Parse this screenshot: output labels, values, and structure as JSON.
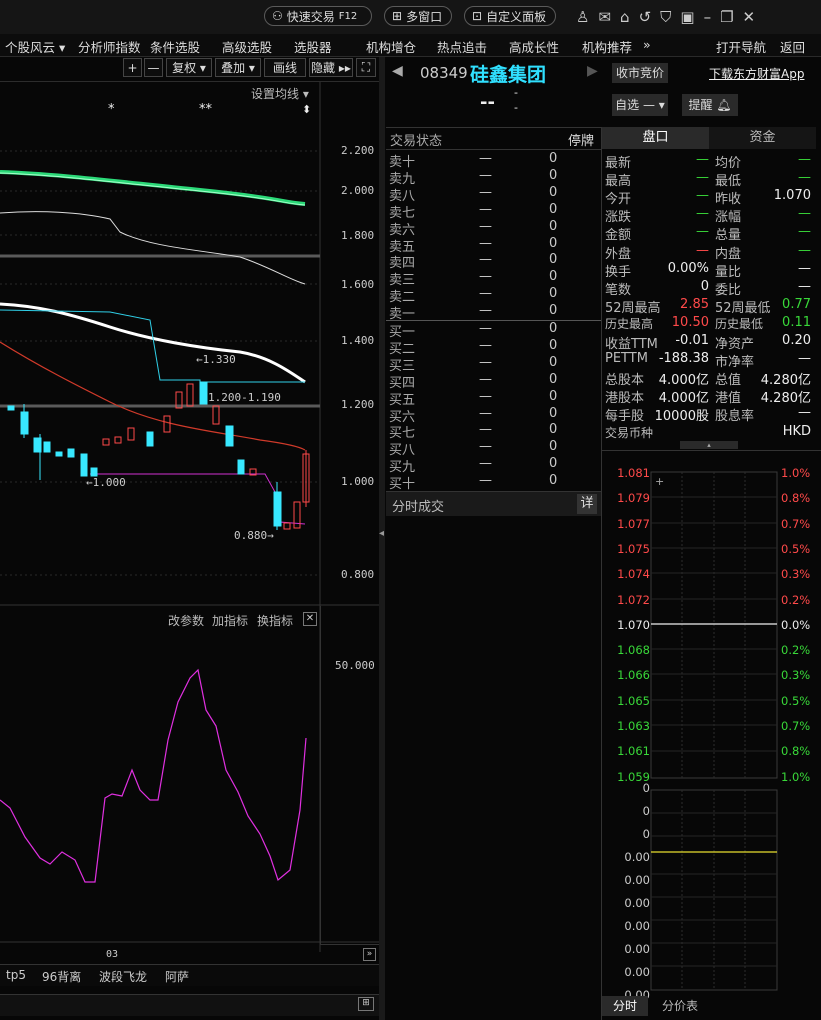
{
  "topbar": {
    "quick_trade": "快速交易",
    "quick_trade_key": "F12",
    "multi_window": "多窗口",
    "custom_panel": "自定义面板"
  },
  "menu": {
    "items": [
      "个股风云",
      "分析师指数",
      "条件选股",
      "高级选股",
      "选股器",
      "机构增仓",
      "热点追击",
      "高成长性",
      "机构推荐"
    ],
    "more": "»",
    "right": [
      "打开导航",
      "返回"
    ]
  },
  "chart_toolbar": {
    "plus": "+",
    "minus": "—",
    "restore": "复权",
    "overlay": "叠加",
    "draw": "画线",
    "hide": "隐藏"
  },
  "ma_setting": "设置均线",
  "stars": [
    "*",
    "**"
  ],
  "price_axis": [
    "2.200",
    "2.000",
    "1.800",
    "1.600",
    "1.400",
    "1.200",
    "1.000",
    "0.800"
  ],
  "annotations": {
    "high": "1.330",
    "gap": "1.200-1.190",
    "low1": "1.000",
    "low2": "0.880"
  },
  "indicator": {
    "params": "改参数",
    "add": "加指标",
    "switch": "换指标",
    "axis": "50.000",
    "xtick": "03"
  },
  "bottom_tabs": [
    "tp5",
    "96背离",
    "波段飞龙",
    "阿萨"
  ],
  "stock": {
    "code": "08349",
    "name": "硅鑫集团",
    "price": "--",
    "change1": "-",
    "change2": "-",
    "btn_market": "收市竞价",
    "download": "下载东方财富App",
    "watch": "自选",
    "remind": "提醒"
  },
  "orderbook": {
    "status_label": "交易状态",
    "status": "停牌",
    "sell": [
      "卖十",
      "卖九",
      "卖八",
      "卖七",
      "卖六",
      "卖五",
      "卖四",
      "卖三",
      "卖二",
      "卖一"
    ],
    "buy": [
      "买一",
      "买二",
      "买三",
      "买四",
      "买五",
      "买六",
      "买七",
      "买八",
      "买九",
      "买十"
    ],
    "dash": "—",
    "zero": "0",
    "ticks_label": "分时成交",
    "detail": "详"
  },
  "panel_tabs": [
    "盘口",
    "资金"
  ],
  "quote": [
    [
      "最新",
      "—",
      "均价",
      "—"
    ],
    [
      "最高",
      "—",
      "最低",
      "—"
    ],
    [
      "今开",
      "—",
      "昨收",
      "1.070"
    ],
    [
      "涨跌",
      "—",
      "涨幅",
      "—"
    ],
    [
      "金额",
      "—",
      "总量",
      "—"
    ],
    [
      "外盘",
      "—",
      "内盘",
      "—"
    ],
    [
      "换手",
      "0.00%",
      "量比",
      "—"
    ],
    [
      "笔数",
      "0",
      "委比",
      "—"
    ],
    [
      "52周最高",
      "2.85",
      "52周最低",
      "0.77"
    ],
    [
      "历史最高",
      "10.50",
      "历史最低",
      "0.11"
    ],
    [
      "收益TTM",
      "-0.01",
      "净资产",
      "0.20"
    ],
    [
      "PETTM",
      "-188.38",
      "市净率",
      "—"
    ],
    [
      "总股本",
      "4.000亿",
      "总值",
      "4.280亿"
    ],
    [
      "港股本",
      "4.000亿",
      "港值",
      "4.280亿"
    ],
    [
      "每手股",
      "10000股",
      "股息率",
      "—"
    ],
    [
      "交易币种",
      "",
      "",
      "HKD"
    ]
  ],
  "intraday": {
    "prices": [
      "1.081",
      "1.079",
      "1.077",
      "1.075",
      "1.074",
      "1.072",
      "1.070",
      "1.068",
      "1.066",
      "1.065",
      "1.063",
      "1.061",
      "1.059"
    ],
    "pcts": [
      "1.0%",
      "0.8%",
      "0.7%",
      "0.5%",
      "0.3%",
      "0.2%",
      "0.0%",
      "0.2%",
      "0.3%",
      "0.5%",
      "0.7%",
      "0.8%",
      "1.0%"
    ],
    "vol_axis": [
      "0",
      "0",
      "0",
      "0.00",
      "0.00",
      "0.00",
      "0.00",
      "0.00",
      "0.00",
      "0.00"
    ],
    "tabs": [
      "分时",
      "分价表"
    ]
  },
  "colors": {
    "up": "#ff4a4a",
    "down": "#39d839",
    "cyan": "#30e0ff",
    "magenta": "#e030e0"
  }
}
